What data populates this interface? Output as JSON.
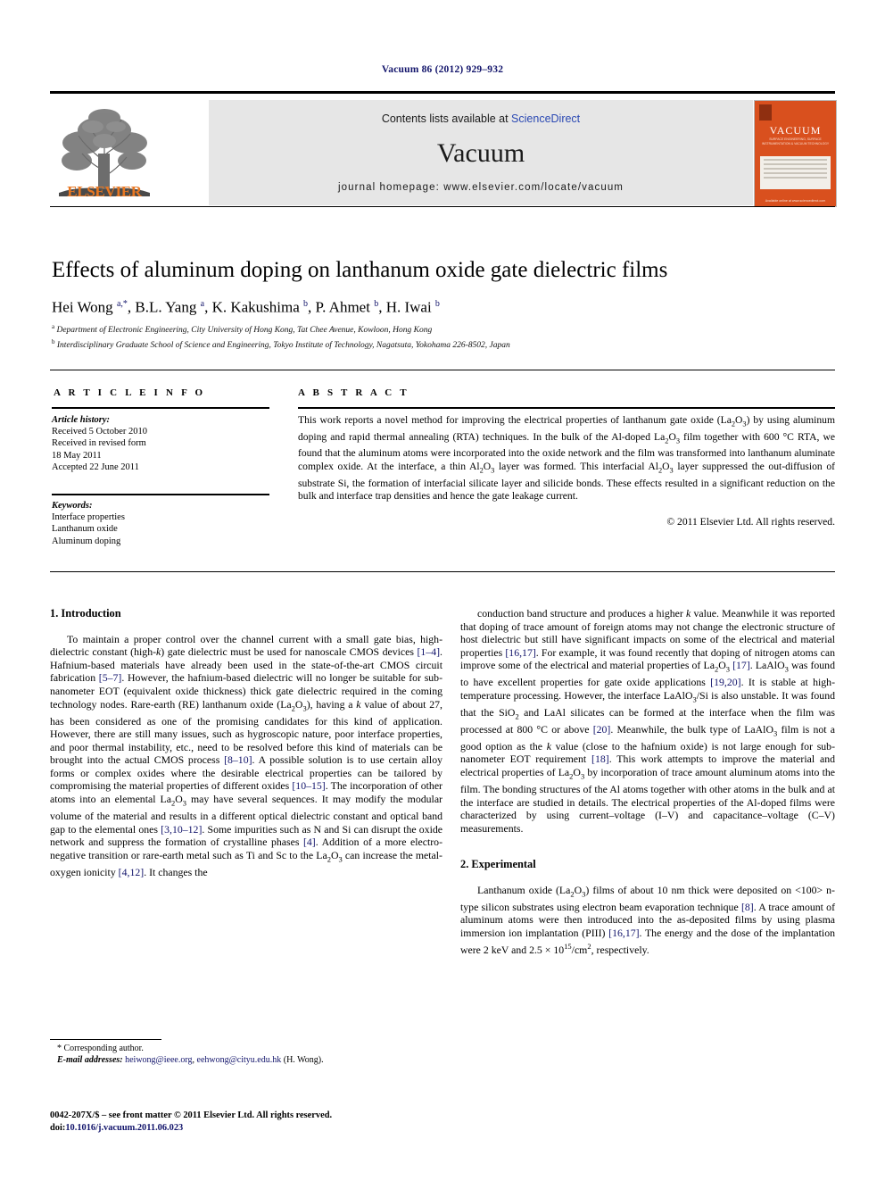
{
  "running_head": "Vacuum 86 (2012) 929–932",
  "masthead": {
    "publisher_wordmark": "ELSEVIER",
    "contents_prefix": "Contents lists available at ",
    "contents_link": "ScienceDirect",
    "journal_title": "Vacuum",
    "homepage": "journal homepage: www.elsevier.com/locate/vacuum",
    "cover": {
      "title": "VACUUM",
      "subtitle": "SURFACE ENGINEERING, SURFACE INSTRUMENTATION & VACUUM TECHNOLOGY",
      "footer": "Available online at www.sciencedirect.com"
    }
  },
  "article": {
    "title": "Effects of aluminum doping on lanthanum oxide gate dielectric films",
    "authors_html": "Hei Wong <sup>a,*</sup>, B.L. Yang <sup>a</sup>, K. Kakushima <sup>b</sup>, P. Ahmet <sup>b</sup>, H. Iwai <sup>b</sup>",
    "affiliation_a": "Department of Electronic Engineering, City University of Hong Kong, Tat Chee Avenue, Kowloon, Hong Kong",
    "affiliation_b": "Interdisciplinary Graduate School of Science and Engineering, Tokyo Institute of Technology, Nagatsuta, Yokohama 226-8502, Japan"
  },
  "article_info": {
    "heading": "A R T I C L E   I N F O",
    "history_label": "Article history:",
    "history": [
      "Received 5 October 2010",
      "Received in revised form",
      "18 May 2011",
      "Accepted 22 June 2011"
    ],
    "keywords_label": "Keywords:",
    "keywords": [
      "Interface properties",
      "Lanthanum oxide",
      "Aluminum doping"
    ]
  },
  "abstract": {
    "heading": "A B S T R A C T",
    "text_html": "This work reports a novel method for improving the electrical properties of lanthanum gate oxide (La<sub>2</sub>O<sub>3</sub>) by using aluminum doping and rapid thermal annealing (RTA) techniques. In the bulk of the Al-doped La<sub>2</sub>O<sub>3</sub> film together with 600 °C RTA, we found that the aluminum atoms were incorporated into the oxide network and the film was transformed into lanthanum aluminate complex oxide. At the interface, a thin Al<sub>2</sub>O<sub>3</sub> layer was formed. This interfacial Al<sub>2</sub>O<sub>3</sub> layer suppressed the out-diffusion of substrate Si, the formation of interfacial silicate layer and silicide bonds. These effects resulted in a significant reduction on the bulk and interface trap densities and hence the gate leakage current.",
    "copyright": "© 2011 Elsevier Ltd. All rights reserved."
  },
  "sections": {
    "introduction_heading": "1. Introduction",
    "introduction_left_html": "To maintain a proper control over the channel current with a small gate bias, high-dielectric constant (high-<span class=\"em\">k</span>) gate dielectric must be used for nanoscale CMOS devices <span class=\"ref\">[1–4]</span>. Hafnium-based materials have already been used in the state-of-the-art CMOS circuit fabrication <span class=\"ref\">[5–7]</span>. However, the hafnium-based dielectric will no longer be suitable for sub-nanometer EOT (equivalent oxide thickness) thick gate dielectric required in the coming technology nodes. Rare-earth (RE) lanthanum oxide (La<sub>2</sub>O<sub>3</sub>), having a <span class=\"em\">k</span> value of about 27, has been considered as one of the promising candidates for this kind of application. However, there are still many issues, such as hygroscopic nature, poor interface properties, and poor thermal instability, etc., need to be resolved before this kind of materials can be brought into the actual CMOS process <span class=\"ref\">[8–10]</span>. A possible solution is to use certain alloy forms or complex oxides where the desirable electrical properties can be tailored by compromising the material properties of different oxides <span class=\"ref\">[10–15]</span>. The incorporation of other atoms into an elemental La<sub>2</sub>O<sub>3</sub> may have several sequences. It may modify the modular volume of the material and results in a different optical dielectric constant and optical band gap to the elemental ones <span class=\"ref\">[3,10–12]</span>. Some impurities such as N and Si can disrupt the oxide network and suppress the formation of crystalline phases <span class=\"ref\">[4]</span>. Addition of a more electro-negative transition or rare-earth metal such as Ti and Sc to the La<sub>2</sub>O<sub>3</sub> can increase the metal-oxygen ionicity <span class=\"ref\">[4,12]</span>. It changes the",
    "introduction_right_html": "conduction band structure and produces a higher <span class=\"em\">k</span> value. Meanwhile it was reported that doping of trace amount of foreign atoms may not change the electronic structure of host dielectric but still have significant impacts on some of the electrical and material properties <span class=\"ref\">[16,17]</span>. For example, it was found recently that doping of nitrogen atoms can improve some of the electrical and material properties of La<sub>2</sub>O<sub>3</sub> <span class=\"ref\">[17]</span>. LaAlO<sub>3</sub> was found to have excellent properties for gate oxide applications <span class=\"ref\">[19,20]</span>. It is stable at high-temperature processing. However, the interface LaAlO<sub>3</sub>/Si is also unstable. It was found that the SiO<sub>2</sub> and LaAl silicates can be formed at the interface when the film was processed at 800 °C or above <span class=\"ref\">[20]</span>. Meanwhile, the bulk type of LaAlO<sub>3</sub> film is not a good option as the <span class=\"em\">k</span> value (close to the hafnium oxide) is not large enough for sub-nanometer EOT requirement <span class=\"ref\">[18]</span>. This work attempts to improve the material and electrical properties of La<sub>2</sub>O<sub>3</sub> by incorporation of trace amount aluminum atoms into the film. The bonding structures of the Al atoms together with other atoms in the bulk and at the interface are studied in details. The electrical properties of the Al-doped films were characterized by using current–voltage (I–V) and capacitance–voltage (C–V) measurements.",
    "experimental_heading": "2. Experimental",
    "experimental_html": "Lanthanum oxide (La<sub>2</sub>O<sub>3</sub>) films of about 10 nm thick were deposited on &lt;100&gt; n-type silicon substrates using electron beam evaporation technique <span class=\"ref\">[8]</span>. A trace amount of aluminum atoms were then introduced into the as-deposited films by using plasma immersion ion implantation (PIII) <span class=\"ref\">[16,17]</span>. The energy and the dose of the implantation were 2 keV and 2.5 × 10<sup class=\"num\">15</sup>/cm<sup class=\"num\">2</sup>, respectively."
  },
  "footnote": {
    "corresponding": "* Corresponding author.",
    "email_label": "E-mail addresses:",
    "email_1": "heiwong@ieee.org",
    "email_2": "eehwong@cityu.edu.hk",
    "email_suffix": "(H. Wong)."
  },
  "footer": {
    "issn_line": "0042-207X/$ – see front matter © 2011 Elsevier Ltd. All rights reserved.",
    "doi_label": "doi:",
    "doi_value": "10.1016/j.vacuum.2011.06.023"
  }
}
